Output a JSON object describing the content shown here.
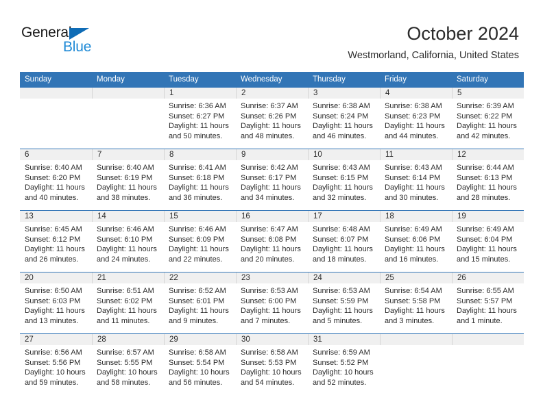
{
  "logo": {
    "word_one": "General",
    "word_two": "Blue",
    "triangle_icon": "triangle-icon",
    "brand_dark": "#1a1a1a",
    "brand_blue": "#1f8ad6",
    "triangle_blue": "#0f6cb6"
  },
  "header": {
    "month_title": "October 2024",
    "location": "Westmorland, California, United States"
  },
  "theme": {
    "header_blue": "#3275b6",
    "date_band_gray": "#f0f0f0",
    "grid_line": "#3275b6",
    "cell_divider": "#d4d4d4",
    "text": "#2b2b2b"
  },
  "calendar": {
    "weekday_headers": [
      "Sunday",
      "Monday",
      "Tuesday",
      "Wednesday",
      "Thursday",
      "Friday",
      "Saturday"
    ],
    "weeks": [
      [
        {
          "day": "",
          "empty": true,
          "sunrise": "",
          "sunset": "",
          "daylight_line1": "",
          "daylight_line2": ""
        },
        {
          "day": "",
          "empty": true,
          "sunrise": "",
          "sunset": "",
          "daylight_line1": "",
          "daylight_line2": ""
        },
        {
          "day": "1",
          "sunrise": "Sunrise: 6:36 AM",
          "sunset": "Sunset: 6:27 PM",
          "daylight_line1": "Daylight: 11 hours",
          "daylight_line2": "and 50 minutes."
        },
        {
          "day": "2",
          "sunrise": "Sunrise: 6:37 AM",
          "sunset": "Sunset: 6:26 PM",
          "daylight_line1": "Daylight: 11 hours",
          "daylight_line2": "and 48 minutes."
        },
        {
          "day": "3",
          "sunrise": "Sunrise: 6:38 AM",
          "sunset": "Sunset: 6:24 PM",
          "daylight_line1": "Daylight: 11 hours",
          "daylight_line2": "and 46 minutes."
        },
        {
          "day": "4",
          "sunrise": "Sunrise: 6:38 AM",
          "sunset": "Sunset: 6:23 PM",
          "daylight_line1": "Daylight: 11 hours",
          "daylight_line2": "and 44 minutes."
        },
        {
          "day": "5",
          "sunrise": "Sunrise: 6:39 AM",
          "sunset": "Sunset: 6:22 PM",
          "daylight_line1": "Daylight: 11 hours",
          "daylight_line2": "and 42 minutes."
        }
      ],
      [
        {
          "day": "6",
          "sunrise": "Sunrise: 6:40 AM",
          "sunset": "Sunset: 6:20 PM",
          "daylight_line1": "Daylight: 11 hours",
          "daylight_line2": "and 40 minutes."
        },
        {
          "day": "7",
          "sunrise": "Sunrise: 6:40 AM",
          "sunset": "Sunset: 6:19 PM",
          "daylight_line1": "Daylight: 11 hours",
          "daylight_line2": "and 38 minutes."
        },
        {
          "day": "8",
          "sunrise": "Sunrise: 6:41 AM",
          "sunset": "Sunset: 6:18 PM",
          "daylight_line1": "Daylight: 11 hours",
          "daylight_line2": "and 36 minutes."
        },
        {
          "day": "9",
          "sunrise": "Sunrise: 6:42 AM",
          "sunset": "Sunset: 6:17 PM",
          "daylight_line1": "Daylight: 11 hours",
          "daylight_line2": "and 34 minutes."
        },
        {
          "day": "10",
          "sunrise": "Sunrise: 6:43 AM",
          "sunset": "Sunset: 6:15 PM",
          "daylight_line1": "Daylight: 11 hours",
          "daylight_line2": "and 32 minutes."
        },
        {
          "day": "11",
          "sunrise": "Sunrise: 6:43 AM",
          "sunset": "Sunset: 6:14 PM",
          "daylight_line1": "Daylight: 11 hours",
          "daylight_line2": "and 30 minutes."
        },
        {
          "day": "12",
          "sunrise": "Sunrise: 6:44 AM",
          "sunset": "Sunset: 6:13 PM",
          "daylight_line1": "Daylight: 11 hours",
          "daylight_line2": "and 28 minutes."
        }
      ],
      [
        {
          "day": "13",
          "sunrise": "Sunrise: 6:45 AM",
          "sunset": "Sunset: 6:12 PM",
          "daylight_line1": "Daylight: 11 hours",
          "daylight_line2": "and 26 minutes."
        },
        {
          "day": "14",
          "sunrise": "Sunrise: 6:46 AM",
          "sunset": "Sunset: 6:10 PM",
          "daylight_line1": "Daylight: 11 hours",
          "daylight_line2": "and 24 minutes."
        },
        {
          "day": "15",
          "sunrise": "Sunrise: 6:46 AM",
          "sunset": "Sunset: 6:09 PM",
          "daylight_line1": "Daylight: 11 hours",
          "daylight_line2": "and 22 minutes."
        },
        {
          "day": "16",
          "sunrise": "Sunrise: 6:47 AM",
          "sunset": "Sunset: 6:08 PM",
          "daylight_line1": "Daylight: 11 hours",
          "daylight_line2": "and 20 minutes."
        },
        {
          "day": "17",
          "sunrise": "Sunrise: 6:48 AM",
          "sunset": "Sunset: 6:07 PM",
          "daylight_line1": "Daylight: 11 hours",
          "daylight_line2": "and 18 minutes."
        },
        {
          "day": "18",
          "sunrise": "Sunrise: 6:49 AM",
          "sunset": "Sunset: 6:06 PM",
          "daylight_line1": "Daylight: 11 hours",
          "daylight_line2": "and 16 minutes."
        },
        {
          "day": "19",
          "sunrise": "Sunrise: 6:49 AM",
          "sunset": "Sunset: 6:04 PM",
          "daylight_line1": "Daylight: 11 hours",
          "daylight_line2": "and 15 minutes."
        }
      ],
      [
        {
          "day": "20",
          "sunrise": "Sunrise: 6:50 AM",
          "sunset": "Sunset: 6:03 PM",
          "daylight_line1": "Daylight: 11 hours",
          "daylight_line2": "and 13 minutes."
        },
        {
          "day": "21",
          "sunrise": "Sunrise: 6:51 AM",
          "sunset": "Sunset: 6:02 PM",
          "daylight_line1": "Daylight: 11 hours",
          "daylight_line2": "and 11 minutes."
        },
        {
          "day": "22",
          "sunrise": "Sunrise: 6:52 AM",
          "sunset": "Sunset: 6:01 PM",
          "daylight_line1": "Daylight: 11 hours",
          "daylight_line2": "and 9 minutes."
        },
        {
          "day": "23",
          "sunrise": "Sunrise: 6:53 AM",
          "sunset": "Sunset: 6:00 PM",
          "daylight_line1": "Daylight: 11 hours",
          "daylight_line2": "and 7 minutes."
        },
        {
          "day": "24",
          "sunrise": "Sunrise: 6:53 AM",
          "sunset": "Sunset: 5:59 PM",
          "daylight_line1": "Daylight: 11 hours",
          "daylight_line2": "and 5 minutes."
        },
        {
          "day": "25",
          "sunrise": "Sunrise: 6:54 AM",
          "sunset": "Sunset: 5:58 PM",
          "daylight_line1": "Daylight: 11 hours",
          "daylight_line2": "and 3 minutes."
        },
        {
          "day": "26",
          "sunrise": "Sunrise: 6:55 AM",
          "sunset": "Sunset: 5:57 PM",
          "daylight_line1": "Daylight: 11 hours",
          "daylight_line2": "and 1 minute."
        }
      ],
      [
        {
          "day": "27",
          "sunrise": "Sunrise: 6:56 AM",
          "sunset": "Sunset: 5:56 PM",
          "daylight_line1": "Daylight: 10 hours",
          "daylight_line2": "and 59 minutes."
        },
        {
          "day": "28",
          "sunrise": "Sunrise: 6:57 AM",
          "sunset": "Sunset: 5:55 PM",
          "daylight_line1": "Daylight: 10 hours",
          "daylight_line2": "and 58 minutes."
        },
        {
          "day": "29",
          "sunrise": "Sunrise: 6:58 AM",
          "sunset": "Sunset: 5:54 PM",
          "daylight_line1": "Daylight: 10 hours",
          "daylight_line2": "and 56 minutes."
        },
        {
          "day": "30",
          "sunrise": "Sunrise: 6:58 AM",
          "sunset": "Sunset: 5:53 PM",
          "daylight_line1": "Daylight: 10 hours",
          "daylight_line2": "and 54 minutes."
        },
        {
          "day": "31",
          "sunrise": "Sunrise: 6:59 AM",
          "sunset": "Sunset: 5:52 PM",
          "daylight_line1": "Daylight: 10 hours",
          "daylight_line2": "and 52 minutes."
        },
        {
          "day": "",
          "empty": true,
          "sunrise": "",
          "sunset": "",
          "daylight_line1": "",
          "daylight_line2": ""
        },
        {
          "day": "",
          "empty": true,
          "sunrise": "",
          "sunset": "",
          "daylight_line1": "",
          "daylight_line2": ""
        }
      ]
    ]
  }
}
